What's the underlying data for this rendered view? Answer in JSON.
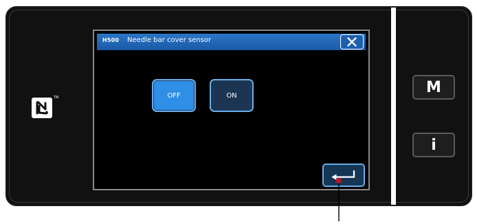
{
  "dialog": {
    "code": "H500",
    "title": "Needle bar cover sensor"
  },
  "options": [
    {
      "label": "OFF",
      "selected": true
    },
    {
      "label": "ON",
      "selected": false
    }
  ],
  "side_buttons": {
    "menu_label": "M",
    "info_label": "i"
  },
  "icons": {
    "close": "close-icon",
    "enter": "enter-icon",
    "nfc": "nfc-icon"
  },
  "colors": {
    "header_blue": "#2b76c8",
    "selected_blue": "#2f8ee6",
    "unselected_navy": "#1b3552",
    "callout_red": "#c0141e"
  }
}
